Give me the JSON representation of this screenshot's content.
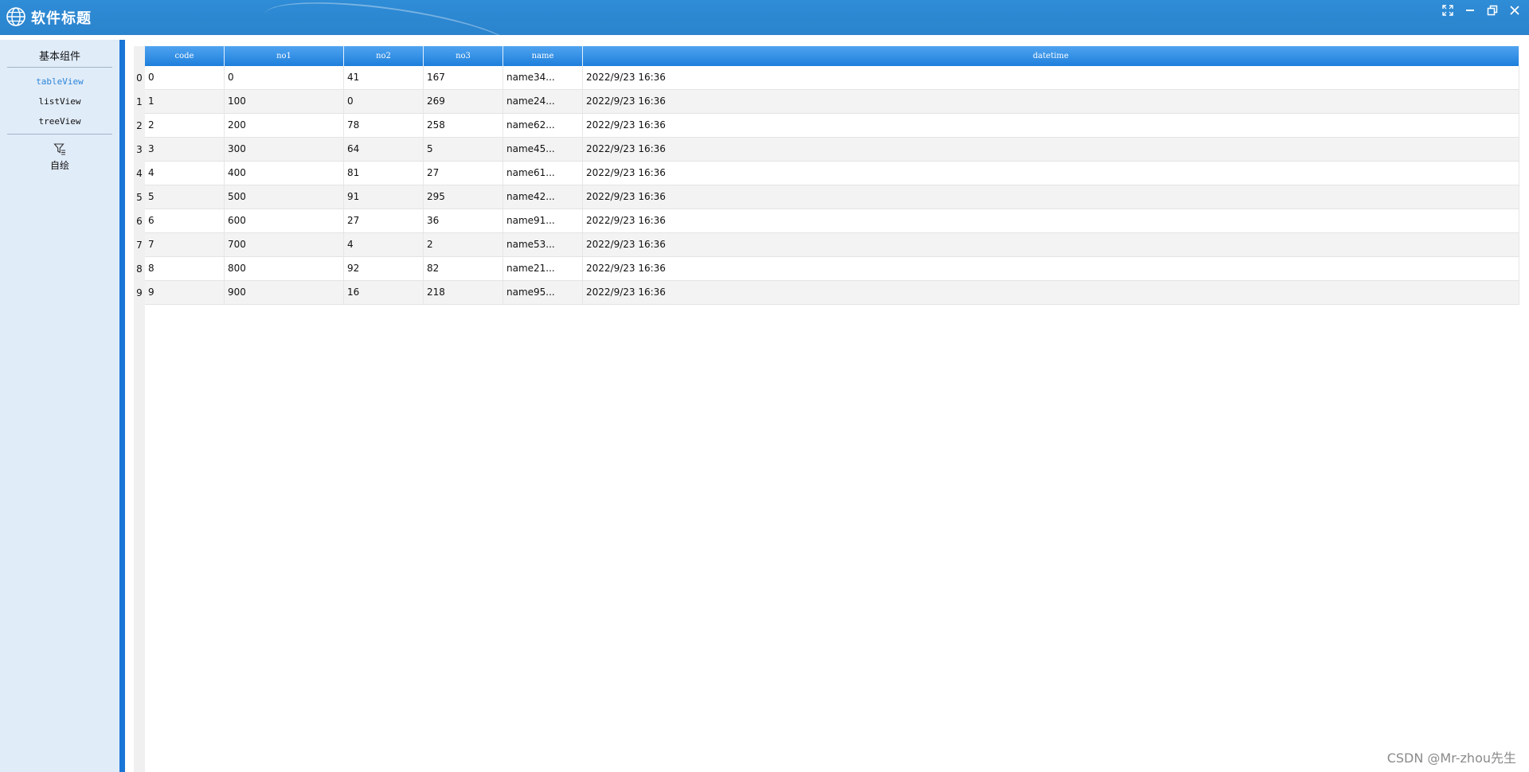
{
  "window": {
    "title": "软件标题"
  },
  "nav": {
    "header": "基本组件",
    "items": [
      {
        "label": "tableView",
        "active": true
      },
      {
        "label": "listView",
        "active": false
      },
      {
        "label": "treeView",
        "active": false
      }
    ],
    "custom": {
      "label": "自绘",
      "icon": "filter-icon"
    }
  },
  "table": {
    "columns": [
      "code",
      "no1",
      "no2",
      "no3",
      "name",
      "datetime"
    ],
    "row_headers": [
      "0",
      "1",
      "2",
      "3",
      "4",
      "5",
      "6",
      "7",
      "8",
      "9"
    ],
    "rows": [
      [
        "0",
        "0",
        "41",
        "167",
        "name34...",
        "2022/9/23 16:36"
      ],
      [
        "1",
        "100",
        "0",
        "269",
        "name24...",
        "2022/9/23 16:36"
      ],
      [
        "2",
        "200",
        "78",
        "258",
        "name62...",
        "2022/9/23 16:36"
      ],
      [
        "3",
        "300",
        "64",
        "5",
        "name45...",
        "2022/9/23 16:36"
      ],
      [
        "4",
        "400",
        "81",
        "27",
        "name61...",
        "2022/9/23 16:36"
      ],
      [
        "5",
        "500",
        "91",
        "295",
        "name42...",
        "2022/9/23 16:36"
      ],
      [
        "6",
        "600",
        "27",
        "36",
        "name91...",
        "2022/9/23 16:36"
      ],
      [
        "7",
        "700",
        "4",
        "2",
        "name53...",
        "2022/9/23 16:36"
      ],
      [
        "8",
        "800",
        "92",
        "82",
        "name21...",
        "2022/9/23 16:36"
      ],
      [
        "9",
        "900",
        "16",
        "218",
        "name95...",
        "2022/9/23 16:36"
      ]
    ]
  },
  "watermark": "CSDN @Mr-zhou先生",
  "colors": {
    "titlebar": "#2a83cd",
    "accent": "#1a76d6",
    "nav_bg": "#e1ecf9",
    "active_item": "#2b86d9"
  }
}
